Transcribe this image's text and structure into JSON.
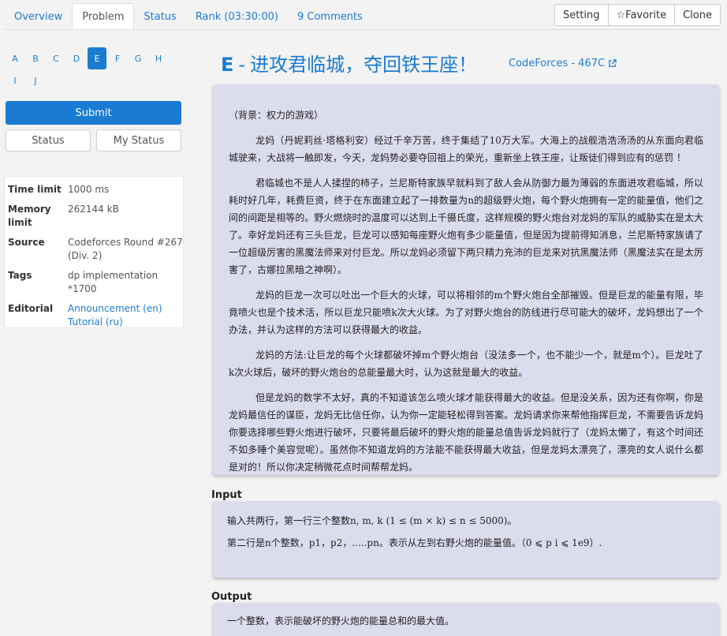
{
  "tabs": [
    "Overview",
    "Problem",
    "Status",
    "Rank (03:30:00)",
    "9 Comments"
  ],
  "actions": {
    "setting": "Setting",
    "favorite": "☆Favorite",
    "clone": "Clone"
  },
  "letters_row1": [
    "A",
    "B",
    "C",
    "D",
    "E",
    "F",
    "G",
    "H"
  ],
  "letters_row2": [
    "I",
    "J"
  ],
  "submit": "Submit",
  "status_buttons": {
    "status": "Status",
    "my_status": "My Status"
  },
  "info": {
    "time_limit_key": "Time limit",
    "time_limit": "1000 ms",
    "memory_limit_key": "Memory limit",
    "memory_limit": "262144 kB",
    "source_key": "Source",
    "source": "Codeforces Round #267 (Div. 2)",
    "tags_key": "Tags",
    "tags": "dp implementation *1700",
    "editorial_key": "Editorial",
    "editorial_1": "Announcement (en)",
    "editorial_2": "Tutorial (ru)"
  },
  "problem": {
    "letter": "E",
    "sep": "-",
    "name": "进攻君临城，夺回铁王座！",
    "source_link": "CodeForces - 467C"
  },
  "legend": [
    "（背景：权力的游戏）",
    "龙妈（丹妮莉丝·塔格利安）经过千辛万苦，终于集结了10万大军。大海上的战舰浩浩汤汤的从东面向君临城驶来，大战将一触即发，今天，龙妈势必要夺回祖上的荣光，重新坐上铁王座，让叛徒们得到应有的惩罚 ！",
    "君临城也不是人人揉捏的柿子，兰尼斯特家族早就料到了敌人会从防御力最为薄弱的东面进攻君临城，所以耗时好几年，耗费巨资，终于在东面建立起了一排数量为n的超级野火炮，每个野火炮拥有一定的能量值，他们之间的间距是相等的。野火燃烧时的温度可以达到上千摄氏度，这样规模的野火炮台对龙妈的军队的威胁实在是太大了。幸好龙妈还有三头巨龙，巨龙可以感知每座野火炮有多少能量值，但是因为提前得知消息，兰尼斯特家族请了一位超级厉害的黑魔法师来对付巨龙。所以龙妈必须留下两只精力充沛的巨龙来对抗黑魔法师（黑魔法实在是太厉害了，古娜拉黑暗之神啊）。",
    "龙妈的巨龙一次可以吐出一个巨大的火球，可以将相邻的m个野火炮台全部摧毁。但是巨龙的能量有限，毕竟喷火也是个技术活，所以巨龙只能喷k次大火球。为了对野火炮台的防线进行尽可能大的破坏，龙妈想出了一个办法，并认为这样的方法可以获得最大的收益。",
    "龙妈的方法:让巨龙的每个火球都破坏掉m个野火炮台（没法多一个，也不能少一个，就是m个）。巨龙吐了k次火球后，破坏的野火炮台的总能量最大时，认为这就是最大的收益。",
    "但是龙妈的数学不太好，真的不知道该怎么喷火球才能获得最大的收益。但是没关系，因为还有你啊，你是龙妈最信任的谋臣，龙妈无比信任你，认为你一定能轻松得到答案。龙妈请求你来帮他指挥巨龙，不需要告诉龙妈你要选择哪些野火炮进行破坏，只要将最后破坏的野火炮的能量总值告诉龙妈就行了（龙妈太懒了，有这个时间还不如多睡个美容觉呢）。虽然你不知道龙妈的方法能不能获得最大收益，但是龙妈太漂亮了，漂亮的女人说什么都是对的！所以你决定稍微花点时间帮帮龙妈。"
  ],
  "input_title": "Input",
  "input": [
    "输入共两行，第一行三个整数n, m, k (1 ≤ (m × k) ≤ n ≤ 5000)。",
    "第二行是n个整数，p1，p2，.....pn。表示从左到右野火炮的能量值。（0 ⩽ p i ⩽ 1e9）."
  ],
  "output_title": "Output",
  "output": [
    "一个整数，表示能破坏的野火炮的能量总和的最大值。"
  ],
  "colors": {
    "accent": "#1a7bd3",
    "card": "#dcdcef",
    "bg": "#f3f3f3"
  }
}
